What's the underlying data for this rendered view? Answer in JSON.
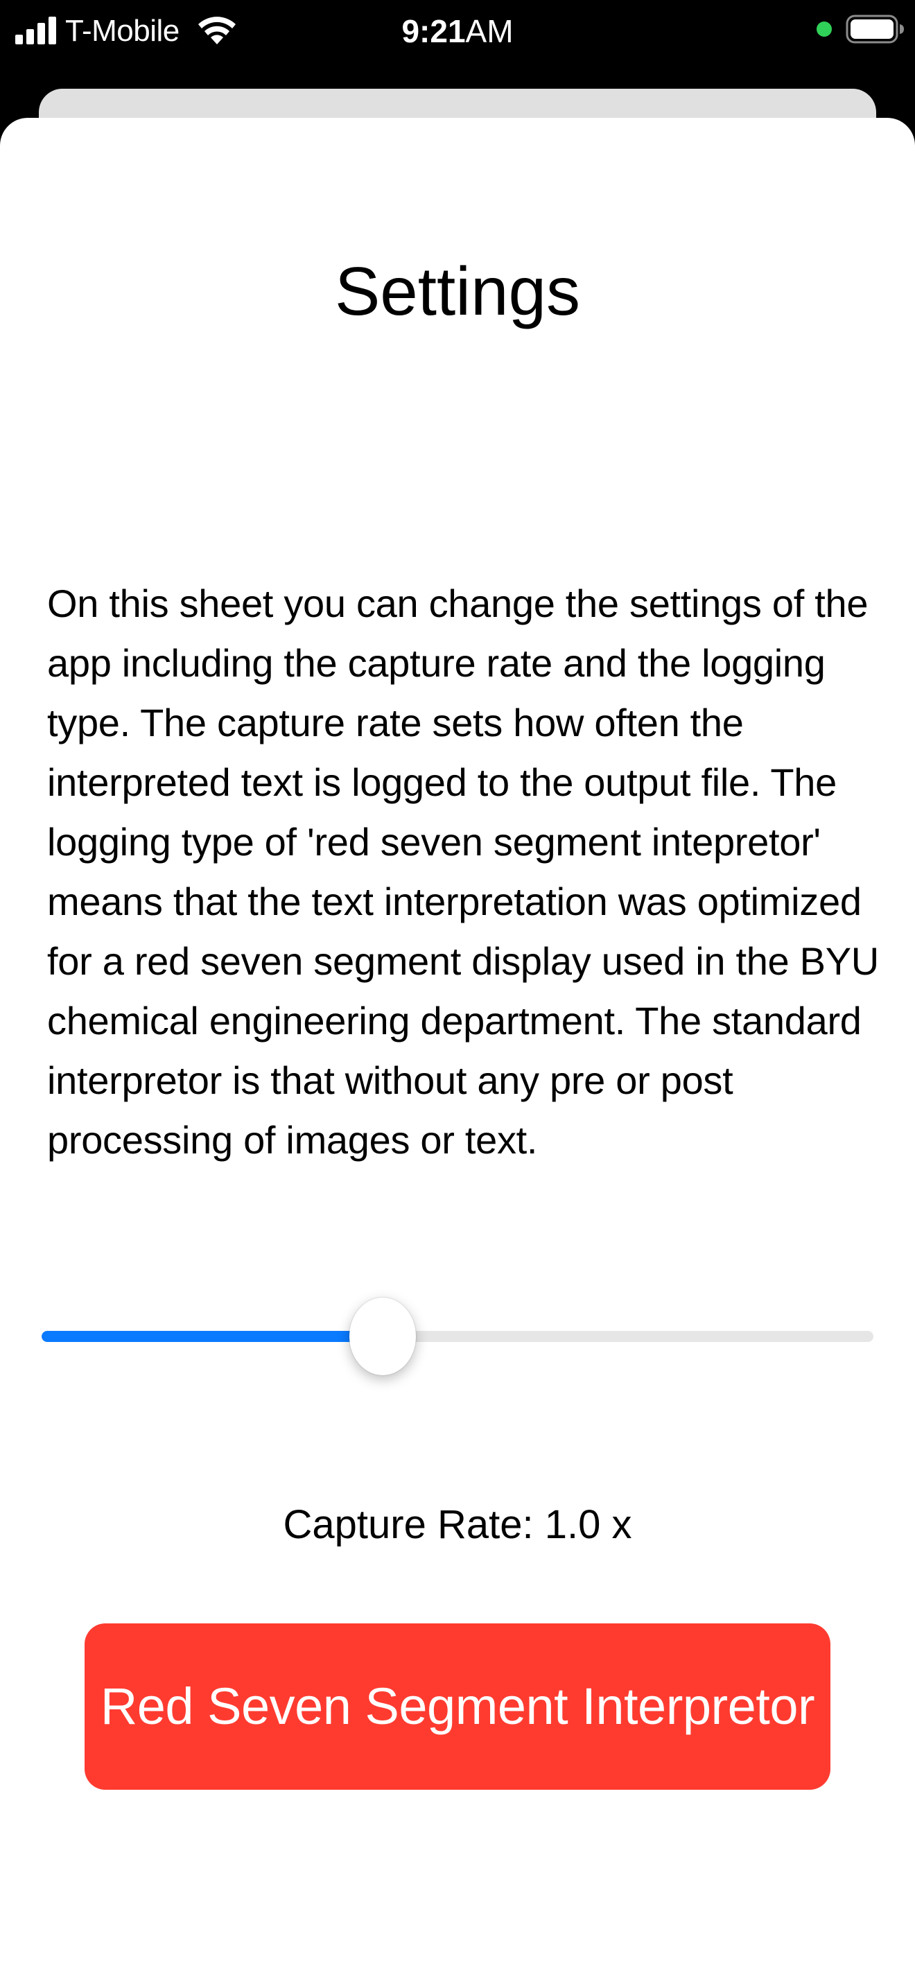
{
  "status_bar": {
    "carrier": "T-Mobile",
    "time": "9:21",
    "time_suffix": "AM",
    "signal_icon": "cellular-signal-icon",
    "wifi_icon": "wifi-icon",
    "battery_icon": "battery-icon",
    "indicator_color": "#30d158"
  },
  "sheet": {
    "title": "Settings",
    "description": "On this sheet you can change the settings of the app including the capture rate and the logging type. The capture rate sets how often the interpreted text is logged to the output file. The logging type of 'red seven segment intepretor' means that the text interpretation was optimized for a red seven segment display used in the BYU chemical engineering department. The standard interpretor is that without any pre or post processing of images or text.",
    "slider": {
      "value_fraction": 0.41,
      "fill_color": "#0a7aff",
      "track_color": "#e6e6e6"
    },
    "capture_rate_label": "Capture Rate: 1.0 x",
    "mode_button": {
      "label": "Red Seven Segment Interpretor",
      "color": "#ff3b30"
    }
  }
}
